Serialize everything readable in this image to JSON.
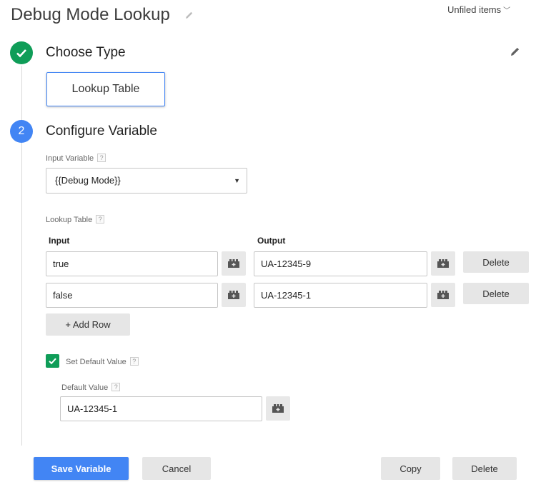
{
  "header": {
    "title": "Debug Mode Lookup",
    "folder_label": "Unfiled items"
  },
  "step1": {
    "title": "Choose Type",
    "selected_type": "Lookup Table"
  },
  "step2": {
    "number": "2",
    "title": "Configure Variable",
    "input_variable_label": "Input Variable",
    "input_variable_value": "{{Debug Mode}}",
    "lookup_table_label": "Lookup Table",
    "col_input": "Input",
    "col_output": "Output",
    "rows": [
      {
        "input": "true",
        "output": "UA-12345-9",
        "delete_label": "Delete"
      },
      {
        "input": "false",
        "output": "UA-12345-1",
        "delete_label": "Delete"
      }
    ],
    "add_row_label": "+ Add Row",
    "set_default_label": "Set Default Value",
    "set_default_checked": true,
    "default_value_label": "Default Value",
    "default_value": "UA-12345-1",
    "help_glyph": "?"
  },
  "footer": {
    "save_label": "Save Variable",
    "cancel_label": "Cancel",
    "copy_label": "Copy",
    "delete_label": "Delete"
  },
  "colors": {
    "primary": "#4285f4",
    "success": "#0f9d58",
    "button_gray": "#e6e6e6"
  },
  "icons": [
    "pencil-icon",
    "check-icon",
    "variable-brick-icon",
    "chevron-down-icon",
    "dropdown-arrow-icon",
    "help-icon"
  ]
}
